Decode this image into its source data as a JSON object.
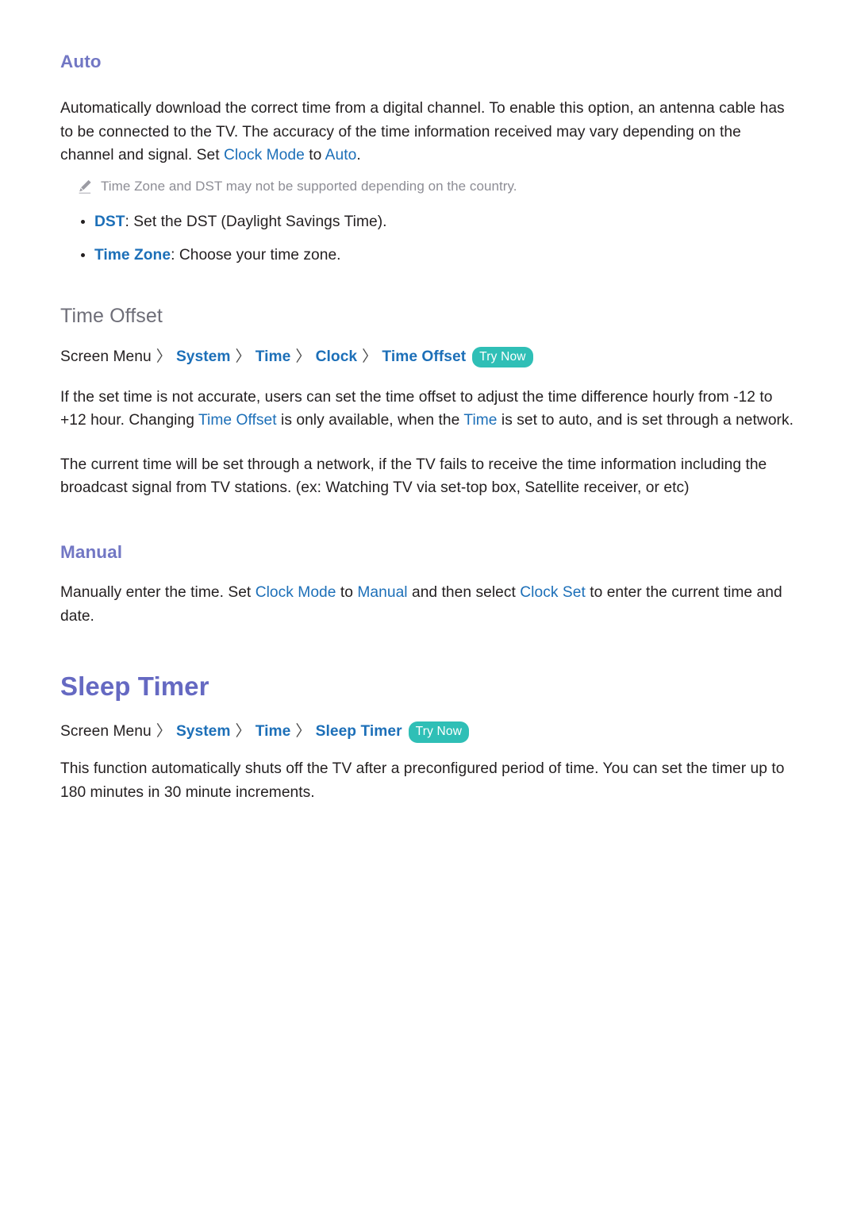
{
  "document": {
    "sections": [
      {
        "id": "auto",
        "heading": "Auto",
        "paragraph_parts": [
          {
            "t": "Automatically download the correct time from a digital channel. To enable this option, an antenna cable has to be connected to the TV. The accuracy of the time information received may vary depending on the channel and signal. Set ",
            "link": false
          },
          {
            "t": "Clock Mode",
            "link": true
          },
          {
            "t": " to ",
            "link": false
          },
          {
            "t": "Auto",
            "link": true
          },
          {
            "t": ".",
            "link": false
          }
        ],
        "note": "Time Zone and DST may not be supported depending on the country.",
        "note_icon": "pencil-icon",
        "bullets": [
          {
            "term": "DST",
            "text": ": Set the DST (Daylight Savings Time)."
          },
          {
            "term": "Time Zone",
            "text": ": Choose your time zone."
          }
        ]
      },
      {
        "id": "time-offset",
        "heading": "Time Offset",
        "breadcrumb": {
          "root": "Screen Menu",
          "separator": "〉",
          "segments": [
            "System",
            "Time",
            "Clock",
            "Time Offset"
          ],
          "try_now_label": "Try Now"
        },
        "paragraphs": [
          [
            {
              "t": "If the set time is not accurate, users can set the time offset to adjust the time difference hourly from -12 to +12 hour. Changing ",
              "link": false
            },
            {
              "t": "Time Offset",
              "link": true
            },
            {
              "t": " is only available, when the ",
              "link": false
            },
            {
              "t": "Time",
              "link": true
            },
            {
              "t": " is set to auto, and is set through a network.",
              "link": false
            }
          ],
          [
            {
              "t": "The current time will be set through a network, if the TV fails to receive the time information including the broadcast signal from TV stations. (ex: Watching TV via set-top box, Satellite receiver, or etc)",
              "link": false
            }
          ]
        ]
      },
      {
        "id": "manual",
        "heading": "Manual",
        "paragraph_parts": [
          {
            "t": "Manually enter the time. Set ",
            "link": false
          },
          {
            "t": "Clock Mode",
            "link": true
          },
          {
            "t": " to ",
            "link": false
          },
          {
            "t": "Manual",
            "link": true
          },
          {
            "t": " and then select ",
            "link": false
          },
          {
            "t": "Clock Set",
            "link": true
          },
          {
            "t": " to enter the current time and date.",
            "link": false
          }
        ]
      },
      {
        "id": "sleep-timer",
        "heading": "Sleep Timer",
        "breadcrumb": {
          "root": "Screen Menu",
          "separator": "〉",
          "segments": [
            "System",
            "Time",
            "Sleep Timer"
          ],
          "try_now_label": "Try Now"
        },
        "paragraphs": [
          [
            {
              "t": "This function automatically shuts off the TV after a preconfigured period of time. You can set the timer up to 180 minutes in 30 minute increments.",
              "link": false
            }
          ]
        ]
      }
    ]
  },
  "colors": {
    "heading_purple": "#7277c4",
    "heading_big_purple": "#6569c2",
    "heading_gray": "#6e6e78",
    "link_blue": "#1c6fb8",
    "body_text": "#231f20",
    "note_gray": "#8d8d95",
    "try_now_bg": "#2fbfb6",
    "try_now_text": "#ffffff",
    "page_bg": "#ffffff"
  }
}
